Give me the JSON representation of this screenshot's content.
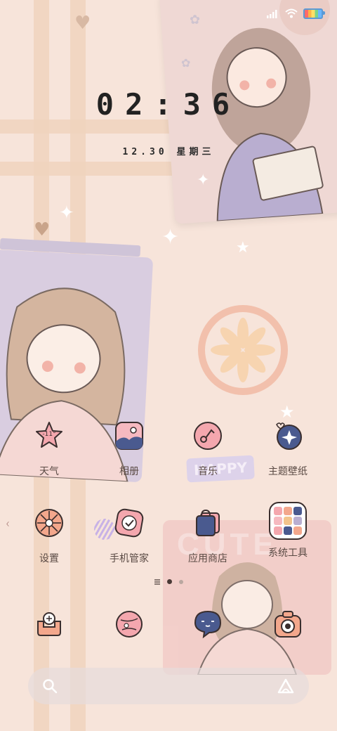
{
  "clock": {
    "time": "02:36",
    "date": "12.30 星期三"
  },
  "apps_row1": [
    {
      "label": "天气",
      "icon": "weather-icon",
      "badge": "-11°"
    },
    {
      "label": "相册",
      "icon": "gallery-icon"
    },
    {
      "label": "音乐",
      "icon": "music-icon"
    },
    {
      "label": "主题壁纸",
      "icon": "themes-icon"
    }
  ],
  "apps_row2": [
    {
      "label": "设置",
      "icon": "settings-icon"
    },
    {
      "label": "手机管家",
      "icon": "security-icon"
    },
    {
      "label": "应用商店",
      "icon": "app-store-icon"
    },
    {
      "label": "系统工具",
      "icon": "system-tools-folder-icon"
    }
  ],
  "dock": [
    {
      "icon": "phone-icon"
    },
    {
      "icon": "browser-icon"
    },
    {
      "icon": "messages-icon"
    },
    {
      "icon": "camera-icon"
    }
  ],
  "wallpaper": {
    "sticker_text_1": "HAPPY",
    "sticker_text_2": "CUTE"
  },
  "colors": {
    "background": "#f7e4da",
    "stripe": "#f0d3bd",
    "accent_pink": "#f2a6a6",
    "navy": "#4a5a8f"
  }
}
